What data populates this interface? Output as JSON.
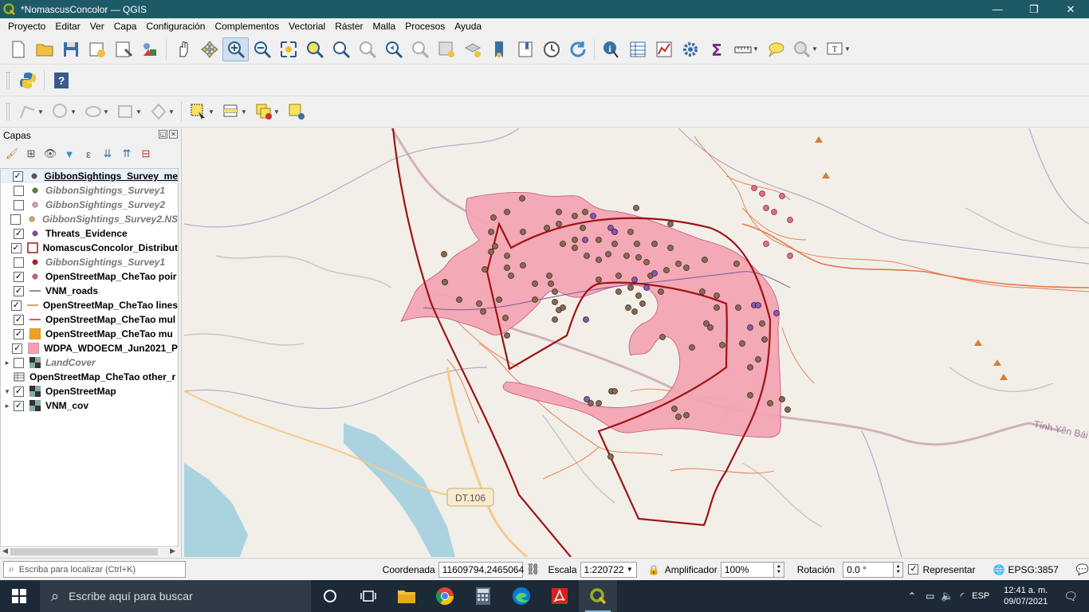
{
  "window": {
    "title": "*NomascusConcolor — QGIS",
    "minimize": "—",
    "restore": "❐",
    "close": "✕"
  },
  "menu": [
    "Proyecto",
    "Editar",
    "Ver",
    "Capa",
    "Configuración",
    "Complementos",
    "Vectorial",
    "Ráster",
    "Malla",
    "Procesos",
    "Ayuda"
  ],
  "layers_panel": {
    "title": "Capas",
    "layers": [
      {
        "name": "GibbonSightings_Survey_me",
        "visible": true,
        "enabled": true,
        "symbol": "dot",
        "color": "#555555",
        "selected": true
      },
      {
        "name": "GibbonSightings_Survey1",
        "visible": false,
        "enabled": false,
        "symbol": "dot",
        "color": "#4e8a3a"
      },
      {
        "name": "GibbonSightings_Survey2",
        "visible": false,
        "enabled": false,
        "symbol": "dot",
        "color": "#e0a0b0"
      },
      {
        "name": "GibbonSightings_Survey2.NS",
        "visible": false,
        "enabled": false,
        "symbol": "dot",
        "color": "#d8b060"
      },
      {
        "name": "Threats_Evidence",
        "visible": true,
        "enabled": true,
        "symbol": "dot",
        "color": "#8a4aa0"
      },
      {
        "name": "NomascusConcolor_Distribut",
        "visible": true,
        "enabled": true,
        "symbol": "outline",
        "color": "#a01818"
      },
      {
        "name": "GibbonSightings_Survey1",
        "visible": false,
        "enabled": false,
        "symbol": "dot",
        "color": "#c01818"
      },
      {
        "name": "OpenStreetMap_CheTao poir",
        "visible": true,
        "enabled": true,
        "symbol": "dot",
        "color": "#d06080"
      },
      {
        "name": "VNM_roads",
        "visible": true,
        "enabled": true,
        "symbol": "line",
        "color": "#7a5a9a"
      },
      {
        "name": "OpenStreetMap_CheTao lines",
        "visible": true,
        "enabled": true,
        "symbol": "line",
        "color": "#e07a4a"
      },
      {
        "name": "OpenStreetMap_CheTao mul",
        "visible": true,
        "enabled": true,
        "symbol": "line",
        "color": "#b03030"
      },
      {
        "name": "OpenStreetMap_CheTao mu",
        "visible": true,
        "enabled": true,
        "symbol": "fill",
        "color": "#f0a020"
      },
      {
        "name": "WDPA_WDOECM_Jun2021_P",
        "visible": true,
        "enabled": true,
        "symbol": "fill",
        "color": "#f4a0b0"
      },
      {
        "name": "LandCover",
        "visible": false,
        "enabled": false,
        "symbol": "raster",
        "color": "#444444",
        "expand": "▸"
      },
      {
        "name": "OpenStreetMap_CheTao other_r",
        "visible": true,
        "enabled": true,
        "symbol": "table",
        "color": "#444444",
        "nocheck": true
      },
      {
        "name": "OpenStreetMap",
        "visible": true,
        "enabled": true,
        "symbol": "raster",
        "color": "#444444",
        "expand": "▾"
      },
      {
        "name": "VNM_cov",
        "visible": true,
        "enabled": true,
        "symbol": "raster",
        "color": "#444444",
        "expand": "▸"
      }
    ]
  },
  "map": {
    "road_label": "DT.106",
    "place_label": "Tính Yên Bái"
  },
  "status": {
    "locator_placeholder": "Escriba para localizar (Ctrl+K)",
    "coord_label": "Coordenada",
    "coord_value": "11609794,2465064",
    "scale_label": "Escala",
    "scale_value": "1:220722",
    "magnifier_label": "Amplificador",
    "magnifier_value": "100%",
    "rotation_label": "Rotación",
    "rotation_value": "0.0 °",
    "render_label": "Representar",
    "crs": "EPSG:3857"
  },
  "taskbar": {
    "search_placeholder": "Escribe aquí para buscar",
    "lang": "ESP",
    "time": "12:41 a. m.",
    "date": "09/07/2021"
  },
  "colors": {
    "protected_area": "#f4a6b4",
    "distribution_outline": "#9e1414",
    "sighting": "#8a6a50",
    "threat": "#8a5aa8",
    "osm_line": "#e8764a",
    "water": "#aad3df"
  }
}
